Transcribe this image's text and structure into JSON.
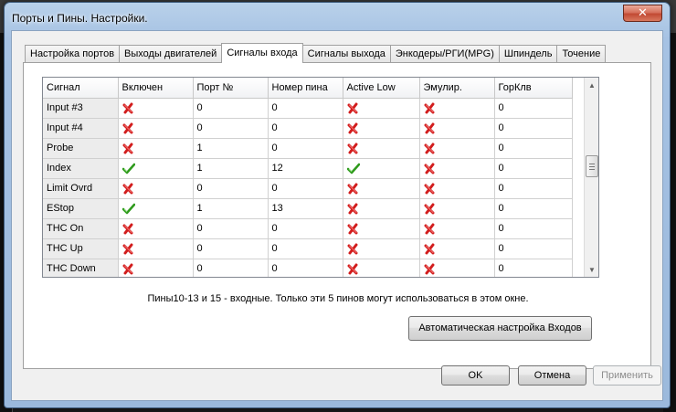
{
  "window": {
    "title": "Порты и Пины.  Настройки.",
    "close_glyph": "✕"
  },
  "tabs": [
    {
      "label": "Настройка портов",
      "active": false
    },
    {
      "label": "Выходы двигателей",
      "active": false
    },
    {
      "label": "Сигналы входа",
      "active": true
    },
    {
      "label": "Сигналы выхода",
      "active": false
    },
    {
      "label": "Энкодеры/РГИ(MPG)",
      "active": false
    },
    {
      "label": "Шпиндель",
      "active": false
    },
    {
      "label": "Точение",
      "active": false
    }
  ],
  "grid": {
    "columns": [
      "Сигнал",
      "Включен",
      "Порт №",
      "Номер пина",
      "Active Low",
      "Эмулир.",
      "ГорКлв"
    ],
    "rows": [
      {
        "signal": "Input #3",
        "enabled": false,
        "port": "0",
        "pin": "0",
        "active_low": false,
        "emulated": false,
        "hotkey": "0"
      },
      {
        "signal": "Input #4",
        "enabled": false,
        "port": "0",
        "pin": "0",
        "active_low": false,
        "emulated": false,
        "hotkey": "0"
      },
      {
        "signal": "Probe",
        "enabled": false,
        "port": "1",
        "pin": "0",
        "active_low": false,
        "emulated": false,
        "hotkey": "0"
      },
      {
        "signal": "Index",
        "enabled": true,
        "port": "1",
        "pin": "12",
        "active_low": true,
        "emulated": false,
        "hotkey": "0"
      },
      {
        "signal": "Limit Ovrd",
        "enabled": false,
        "port": "0",
        "pin": "0",
        "active_low": false,
        "emulated": false,
        "hotkey": "0"
      },
      {
        "signal": "EStop",
        "enabled": true,
        "port": "1",
        "pin": "13",
        "active_low": false,
        "emulated": false,
        "hotkey": "0"
      },
      {
        "signal": "THC On",
        "enabled": false,
        "port": "0",
        "pin": "0",
        "active_low": false,
        "emulated": false,
        "hotkey": "0"
      },
      {
        "signal": "THC Up",
        "enabled": false,
        "port": "0",
        "pin": "0",
        "active_low": false,
        "emulated": false,
        "hotkey": "0"
      },
      {
        "signal": "THC Down",
        "enabled": false,
        "port": "0",
        "pin": "0",
        "active_low": false,
        "emulated": false,
        "hotkey": "0"
      }
    ],
    "scroll": {
      "up_glyph": "▲",
      "down_glyph": "▼"
    }
  },
  "note": "Пины10-13 и 15 - входные. Только эти 5 пинов могут использоваться в этом окне.",
  "buttons": {
    "auto_setup": "Автоматическая настройка Входов",
    "ok": "OK",
    "cancel": "Отмена",
    "apply": "Применить"
  },
  "icons": {
    "on": "green-check-icon",
    "off": "red-x-icon"
  },
  "colors": {
    "check": "#2e9a1c",
    "cross": "#d21d1d",
    "frame": "#a6c2e3",
    "close": "#c24a33"
  }
}
